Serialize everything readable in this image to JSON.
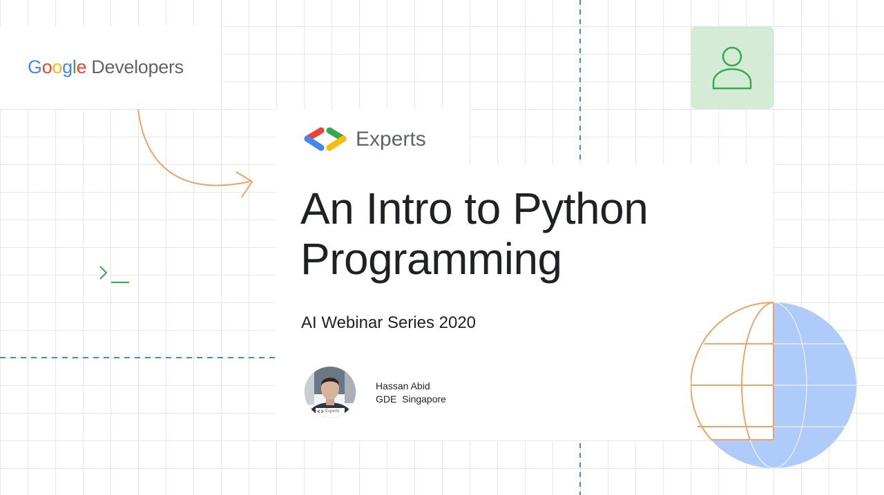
{
  "brand": {
    "google_letters": [
      "G",
      "o",
      "o",
      "g",
      "l",
      "e"
    ],
    "developers": "Developers",
    "experts": "Experts"
  },
  "title": {
    "line1": "An Intro to Python",
    "line2": "Programming"
  },
  "subtitle": "AI Webinar Series 2020",
  "speaker": {
    "name": "Hassan Abid",
    "role": "GDE  Singapore",
    "badge": "Experts"
  },
  "colors": {
    "google_blue": "#4285F4",
    "google_red": "#EA4335",
    "google_yellow": "#FBBC05",
    "google_green": "#34A853",
    "orange_accent": "#F4A261",
    "person_card_bg": "#D4EBD6",
    "globe_blue": "#AECBFA",
    "dashed_line": "#4285F4"
  },
  "icons": [
    "person-icon",
    "terminal-prompt-icon",
    "curved-arrow-icon",
    "globe-icon",
    "experts-chevron-icon"
  ]
}
